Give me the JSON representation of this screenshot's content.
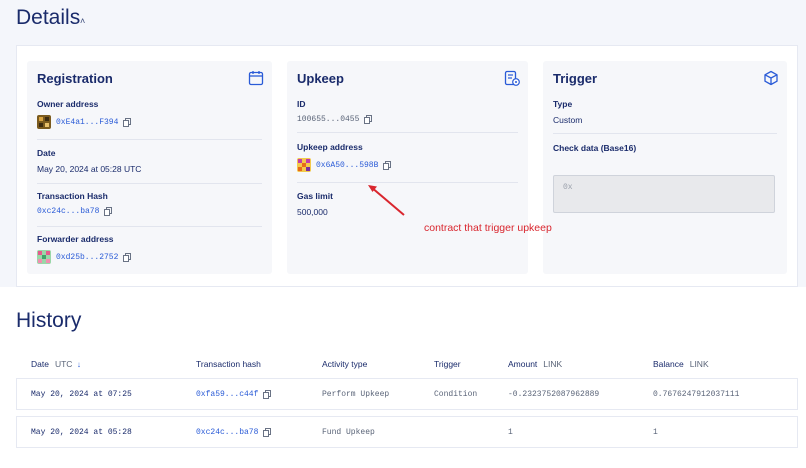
{
  "details": {
    "title": "Details",
    "registration": {
      "title": "Registration",
      "owner_label": "Owner address",
      "owner_value": "0xE4a1...F394",
      "date_label": "Date",
      "date_value": "May 20, 2024 at 05:28 UTC",
      "tx_label": "Transaction Hash",
      "tx_value": "0xc24c...ba78",
      "forwarder_label": "Forwarder address",
      "forwarder_value": "0xd25b...2752"
    },
    "upkeep": {
      "title": "Upkeep",
      "id_label": "ID",
      "id_value": "100655...0455",
      "address_label": "Upkeep address",
      "address_value": "0x6A50...598B",
      "gas_label": "Gas limit",
      "gas_value": "500,000"
    },
    "trigger": {
      "title": "Trigger",
      "type_label": "Type",
      "type_value": "Custom",
      "check_label": "Check data (Base16)",
      "check_placeholder": "0x"
    }
  },
  "annotation": "contract that trigger upkeep",
  "history": {
    "title": "History",
    "headers": {
      "date": "Date",
      "date_sub": "UTC",
      "tx": "Transaction hash",
      "activity": "Activity type",
      "trigger": "Trigger",
      "amount": "Amount",
      "amount_sub": "LINK",
      "balance": "Balance",
      "balance_sub": "LINK"
    },
    "rows": [
      {
        "date": "May 20, 2024 at 07:25",
        "tx": "0xfa59...c44f",
        "activity": "Perform Upkeep",
        "trigger": "Condition",
        "amount": "-0.2323752087962889",
        "balance": "0.7676247912037111"
      },
      {
        "date": "May 20, 2024 at 05:28",
        "tx": "0xc24c...ba78",
        "activity": "Fund Upkeep",
        "trigger": "",
        "amount": "1",
        "balance": "1"
      }
    ]
  },
  "colors": {
    "accent": "#2a5bd7",
    "annotation": "#d9262e",
    "heading": "#1a2b6b"
  }
}
